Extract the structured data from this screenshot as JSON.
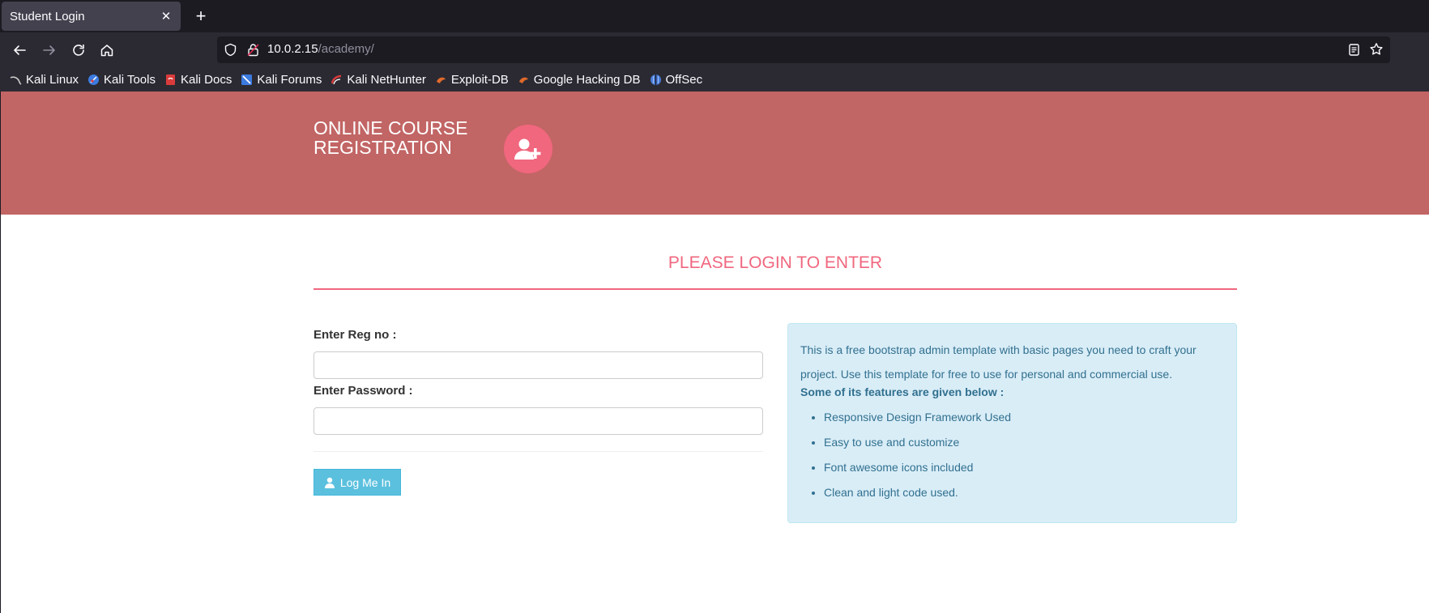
{
  "browser": {
    "tab_title": "Student Login",
    "tab_close": "✕",
    "new_tab": "+",
    "url_host": "10.0.2.15",
    "url_path": "/academy/"
  },
  "bookmarks": [
    {
      "label": "Kali Linux",
      "icon": "kali-linux-icon",
      "color": "#9aa0a6"
    },
    {
      "label": "Kali Tools",
      "icon": "kali-tools-icon",
      "color": "#3c7be0"
    },
    {
      "label": "Kali Docs",
      "icon": "kali-docs-icon",
      "color": "#d93b3b"
    },
    {
      "label": "Kali Forums",
      "icon": "kali-forums-icon",
      "color": "#3c7be0"
    },
    {
      "label": "Kali NetHunter",
      "icon": "kali-nethunter-icon",
      "color": "#d93b3b"
    },
    {
      "label": "Exploit-DB",
      "icon": "exploit-db-icon",
      "color": "#e06a2c"
    },
    {
      "label": "Google Hacking DB",
      "icon": "google-hacking-db-icon",
      "color": "#e06a2c"
    },
    {
      "label": "OffSec",
      "icon": "offsec-icon",
      "color": "#4a7dd8"
    }
  ],
  "header": {
    "brand_line1": "ONLINE COURSE",
    "brand_line2": "REGISTRATION",
    "brand_icon": "user-plus-icon",
    "color": "#c26565",
    "accent": "#f0677e"
  },
  "login": {
    "title": "PLEASE LOGIN TO ENTER",
    "reg_label": "Enter Reg no :",
    "reg_value": "",
    "password_label": "Enter Password :",
    "password_value": "",
    "button_label": "Log Me In",
    "button_icon": "user-icon",
    "button_color": "#5bc0de"
  },
  "info": {
    "text": "This is a free bootstrap admin template with basic pages you need to craft your project. Use this template for free to use for personal and commercial use.",
    "features_heading": "Some of its features are given below :",
    "features": [
      "Responsive Design Framework Used",
      "Easy to use and customize",
      "Font awesome icons included",
      "Clean and light code used."
    ],
    "background": "#d9edf7",
    "text_color": "#31708f"
  }
}
